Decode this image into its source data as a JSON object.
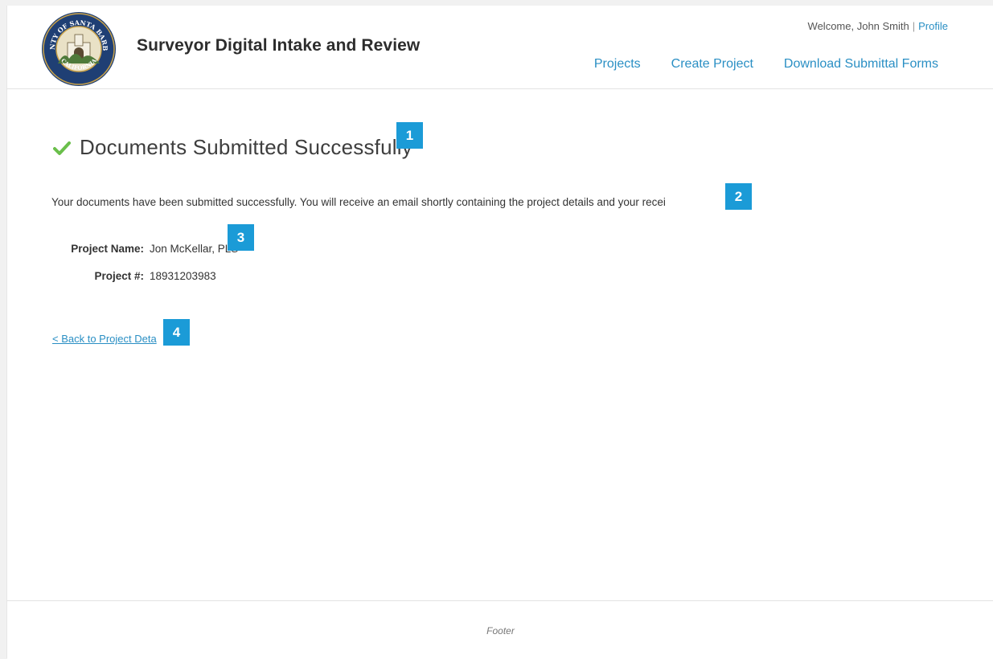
{
  "header": {
    "seal_text_top": "COUNTY OF SANTA BARBARA",
    "seal_text_bottom": "CALIFORNIA",
    "app_title": "Surveyor Digital Intake and Review",
    "welcome_text": "Welcome, John Smith",
    "separator": "|",
    "profile_link": "Profile",
    "nav": [
      {
        "label": "Projects"
      },
      {
        "label": "Create Project"
      },
      {
        "label": "Download Submittal Forms"
      }
    ]
  },
  "main": {
    "heading": "Documents Submitted Successfully",
    "message": "Your documents have been submitted successfully. You will receive an email shortly containing the project details and your recei",
    "details": [
      {
        "label": "Project Name:",
        "value": "Jon McKellar, PLS"
      },
      {
        "label": "Project #:",
        "value": "18931203983"
      }
    ],
    "back_link": "< Back to Project Deta"
  },
  "markers": [
    "1",
    "2",
    "3",
    "4"
  ],
  "footer": {
    "text": "Footer"
  },
  "colors": {
    "link": "#2a8fc4",
    "marker": "#1b9bd7",
    "success": "#6abf4b"
  }
}
